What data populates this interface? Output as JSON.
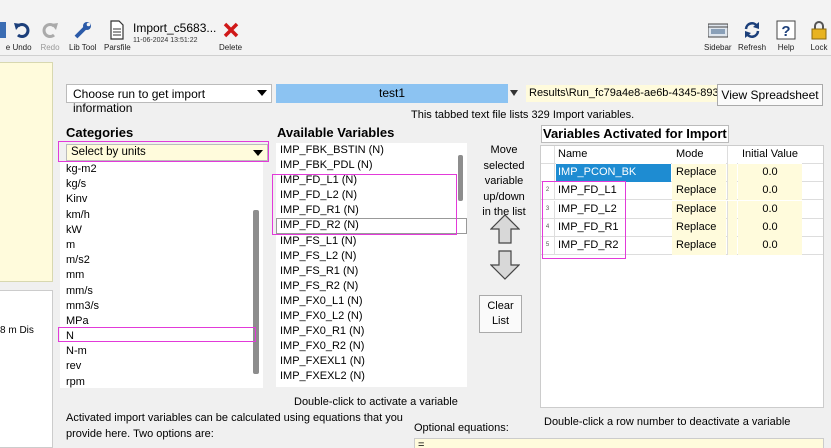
{
  "toolbar": {
    "buttons": [
      {
        "label": "e",
        "icon": "save-icon"
      },
      {
        "label": "Undo",
        "icon": "undo-icon"
      },
      {
        "label": "Redo",
        "icon": "redo-icon"
      },
      {
        "label": "Lib Tool",
        "icon": "wrench-icon"
      },
      {
        "label": "Parsfile",
        "icon": "document-icon"
      },
      {
        "label": "Delete",
        "icon": "delete-icon"
      },
      {
        "label": "Sidebar",
        "icon": "sidebar-icon"
      },
      {
        "label": "Refresh",
        "icon": "refresh-icon"
      },
      {
        "label": "Help",
        "icon": "help-icon"
      },
      {
        "label": "Lock",
        "icon": "lock-icon"
      }
    ],
    "file_title": "Import_c5683...",
    "file_date": "11-06-2024 13:51:22"
  },
  "left_panel": {
    "text": "8 m Dis"
  },
  "run": {
    "select_label": "Choose run to get import information",
    "value": "test1",
    "results_path": "Results\\Run_fc79a4e8-ae6b-4345-893",
    "view_button": "View Spreadsheet",
    "info": "This tabbed text file lists 329 Import variables."
  },
  "categories": {
    "heading": "Categories",
    "select_value": "Select by units",
    "items": [
      "kg-m2",
      "kg/s",
      "Kinv",
      "km/h",
      "kW",
      "m",
      "m/s2",
      "mm",
      "mm/s",
      "mm3/s",
      "MPa",
      "N",
      "N-m",
      "rev",
      "rpm"
    ]
  },
  "available": {
    "heading": "Available Variables",
    "items": [
      "IMP_FBK_BSTIN (N)",
      "IMP_FBK_PDL (N)",
      "IMP_FD_L1 (N)",
      "IMP_FD_L2 (N)",
      "IMP_FD_R1 (N)",
      "IMP_FD_R2 (N)",
      "IMP_FS_L1 (N)",
      "IMP_FS_L2 (N)",
      "IMP_FS_R1 (N)",
      "IMP_FS_R2 (N)",
      "IMP_FX0_L1 (N)",
      "IMP_FX0_L2 (N)",
      "IMP_FX0_R1 (N)",
      "IMP_FX0_R2 (N)",
      "IMP_FXEXL1 (N)",
      "IMP_FXEXL2 (N)"
    ],
    "caption": "Double-click to activate a variable"
  },
  "middle": {
    "move_text": "Move selected variable up/down in the list",
    "clear_button": "Clear List"
  },
  "activated": {
    "heading": "Variables Activated for Import",
    "columns": {
      "name": "Name",
      "mode": "Mode",
      "initial": "Initial Value"
    },
    "rows": [
      {
        "num": "",
        "name": "IMP_PCON_BK",
        "mode": "Replace",
        "initial": "0.0"
      },
      {
        "num": "2",
        "name": "IMP_FD_L1",
        "mode": "Replace",
        "initial": "0.0"
      },
      {
        "num": "3",
        "name": "IMP_FD_L2",
        "mode": "Replace",
        "initial": "0.0"
      },
      {
        "num": "4",
        "name": "IMP_FD_R1",
        "mode": "Replace",
        "initial": "0.0"
      },
      {
        "num": "5",
        "name": "IMP_FD_R2",
        "mode": "Replace",
        "initial": "0.0"
      }
    ],
    "caption": "Double-click a row number to deactivate a variable"
  },
  "bottom": {
    "text": "Activated import variables can be calculated using equations that you provide here. Two options are:",
    "optional_label": "Optional equations:",
    "optional_value": "="
  },
  "colors": {
    "highlight": "#e23ad9",
    "selection": "#1e8cd2",
    "run_value_bg": "#8cc3f2",
    "yellow_field": "#fffbdc"
  }
}
